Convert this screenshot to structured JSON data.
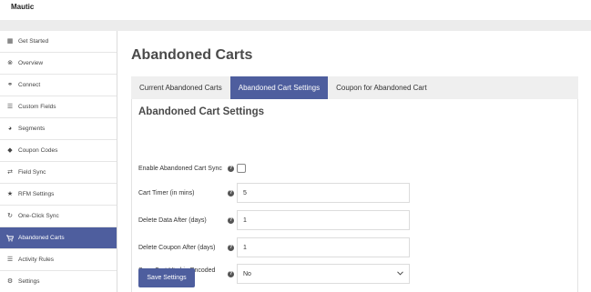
{
  "app": {
    "brand": "Mautic"
  },
  "sidebar": {
    "items": [
      {
        "label": "Get Started",
        "icon": "grid-icon",
        "glyph": "▦"
      },
      {
        "label": "Overview",
        "icon": "close-circle-icon",
        "glyph": "⊗"
      },
      {
        "label": "Connect",
        "icon": "link-icon",
        "glyph": "⚭"
      },
      {
        "label": "Custom Fields",
        "icon": "list-icon",
        "glyph": "☰"
      },
      {
        "label": "Segments",
        "icon": "pie-chart-icon",
        "glyph": "◕"
      },
      {
        "label": "Coupon Codes",
        "icon": "tag-icon",
        "glyph": "◆"
      },
      {
        "label": "Field Sync",
        "icon": "sync-arrows-icon",
        "glyph": "⇄"
      },
      {
        "label": "RFM Settings",
        "icon": "star-icon",
        "glyph": "★"
      },
      {
        "label": "One-Click Sync",
        "icon": "refresh-icon",
        "glyph": "↻"
      },
      {
        "label": "Abandoned Carts",
        "icon": "cart-icon",
        "glyph": "▭",
        "active": true
      },
      {
        "label": "Activity Rules",
        "icon": "list-icon",
        "glyph": "☰"
      },
      {
        "label": "Settings",
        "icon": "gears-icon",
        "glyph": "⚙"
      }
    ]
  },
  "main": {
    "title": "Abandoned Carts",
    "tabs": [
      {
        "label": "Current Abandoned Carts",
        "active": false
      },
      {
        "label": "Abandoned Cart Settings",
        "active": true
      },
      {
        "label": "Coupon for Abandoned Cart",
        "active": false
      }
    ],
    "panel": {
      "title": "Abandoned Cart Settings",
      "fields": {
        "sync": {
          "label": "Enable Abandoned Cart Sync",
          "checked": false
        },
        "timer": {
          "label": "Cart Timer (in mins)",
          "value": "5"
        },
        "delete_data": {
          "label": "Delete Data After (days)",
          "value": "1"
        },
        "delete_coupon": {
          "label": "Delete Coupon After (days)",
          "value": "1"
        },
        "encoded": {
          "label": "Save Cart Html in Encoded form",
          "value": "No"
        }
      },
      "save_label": "Save Settings"
    }
  },
  "colors": {
    "accent": "#4e5e9e",
    "tab_bar": "#efefef",
    "top_strip": "#ececec"
  }
}
